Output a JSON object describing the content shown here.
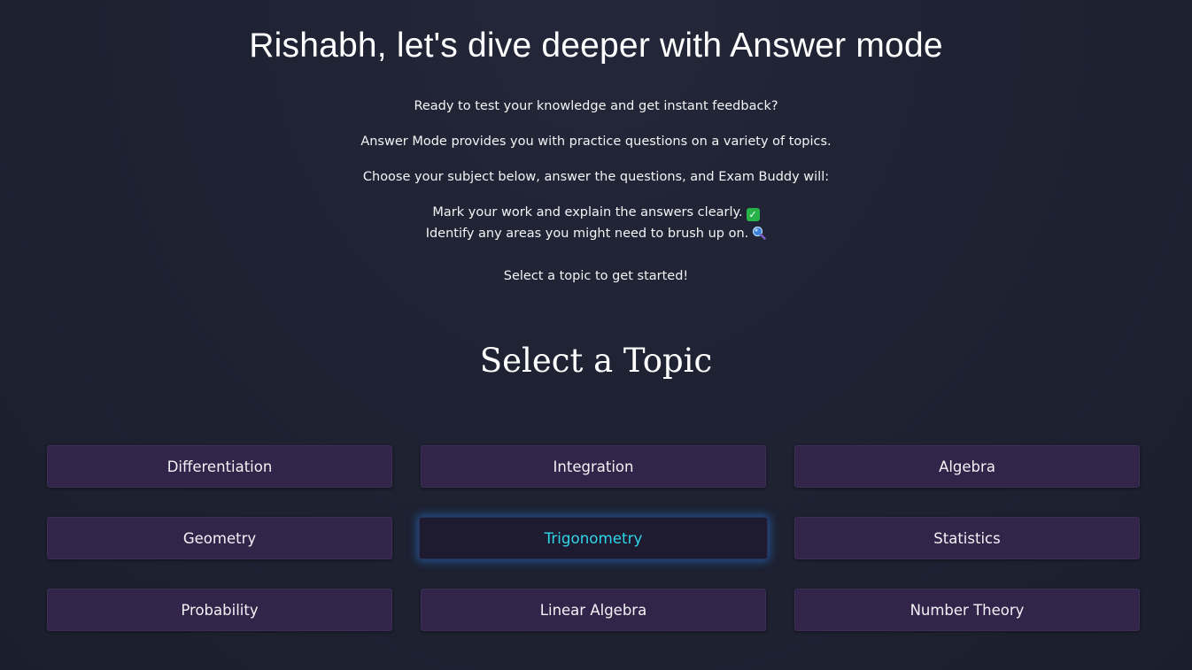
{
  "header": {
    "title": "Rishabh, let's dive deeper with Answer mode"
  },
  "intro": {
    "line1": "Ready to test your knowledge and get instant feedback?",
    "line2": "Answer Mode provides you with practice questions on a variety of topics.",
    "line3": "Choose your subject below, answer the questions, and Exam Buddy will:",
    "bullets": [
      {
        "text": "Mark your work and explain the answers clearly.",
        "icon": "check-icon"
      },
      {
        "text": "Identify any areas you might need to brush up on.",
        "icon": "magnifier-icon"
      }
    ],
    "cta": "Select a topic to get started!"
  },
  "topics": {
    "title": "Select a Topic",
    "items": [
      {
        "label": "Differentiation",
        "active": false
      },
      {
        "label": "Integration",
        "active": false
      },
      {
        "label": "Algebra",
        "active": false
      },
      {
        "label": "Geometry",
        "active": false
      },
      {
        "label": "Trigonometry",
        "active": true
      },
      {
        "label": "Statistics",
        "active": false
      },
      {
        "label": "Probability",
        "active": false
      },
      {
        "label": "Linear Algebra",
        "active": false
      },
      {
        "label": "Number Theory",
        "active": false
      }
    ]
  },
  "colors": {
    "background": "#1e2232",
    "button": "#33244a",
    "active_text": "#2fd5e8",
    "active_glow": "#2878dc",
    "check": "#27b34a"
  }
}
